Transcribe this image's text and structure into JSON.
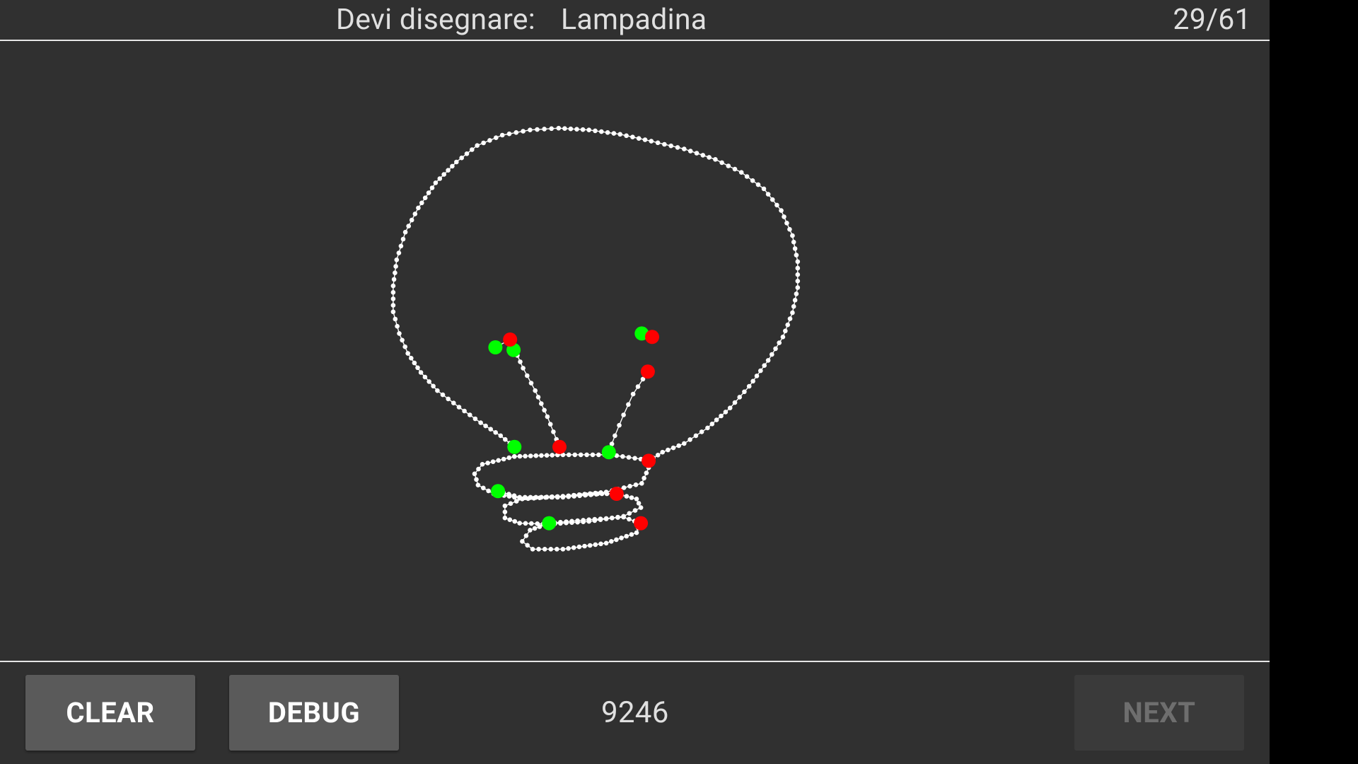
{
  "header": {
    "prompt_label": "Devi disegnare:",
    "word": "Lampadina",
    "progress": "29/61"
  },
  "footer": {
    "clear_label": "CLEAR",
    "debug_label": "DEBUG",
    "score": "9246",
    "next_label": "NEXT",
    "next_enabled": false
  },
  "colors": {
    "background": "#303030",
    "stroke_point": "#ffffff",
    "stroke_start": "#00ff00",
    "stroke_end": "#ff0000"
  }
}
